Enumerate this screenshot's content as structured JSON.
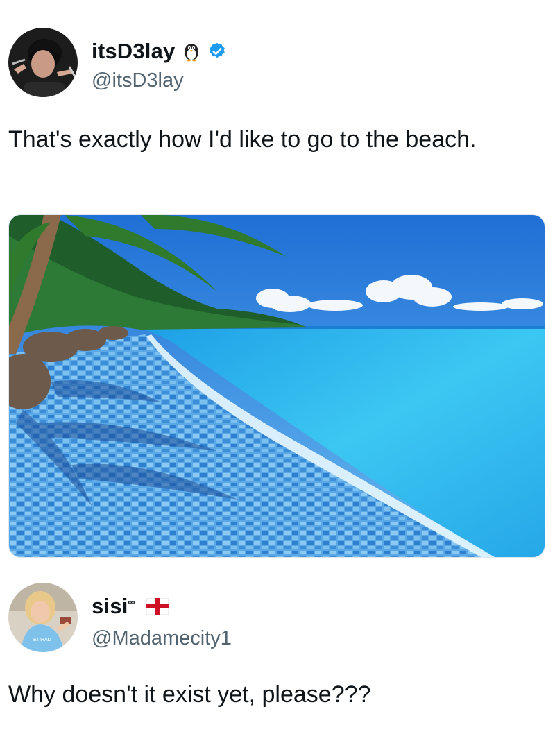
{
  "post": {
    "author": {
      "display_name": "itsD3lay",
      "handle": "@itsD3lay",
      "badge_emoji_icon": "penguin-icon",
      "verified_icon": "verified-badge-icon",
      "verified_color": "#1d9bf0"
    },
    "text": "That's exactly how I'd like to go to the beach.",
    "media": {
      "icon": "beach-photo",
      "colors": {
        "sky": "#2f8ee6",
        "sea": "#2bb6f0",
        "tiles": "#4a9fe0"
      }
    }
  },
  "reply": {
    "author": {
      "display_name": "sisi",
      "superscript": "∞",
      "handle": "@Madamecity1",
      "flag_icon": "england-flag-icon"
    },
    "text": "Why doesn't it exist yet, please???"
  }
}
